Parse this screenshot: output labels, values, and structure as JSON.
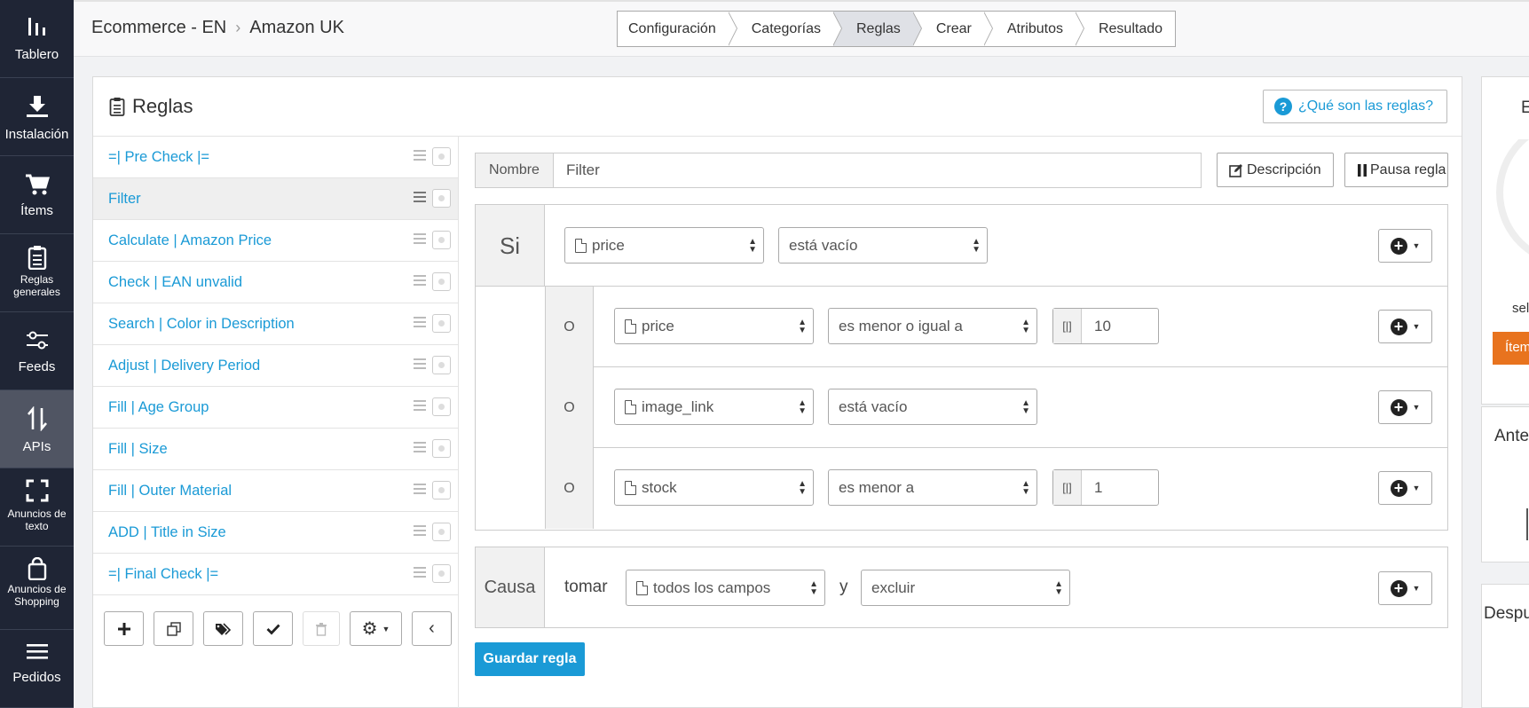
{
  "sidebar": {
    "items": [
      {
        "label": "Tablero",
        "icon": "dashboard-icon"
      },
      {
        "label": "Instalación",
        "icon": "download-icon"
      },
      {
        "label": "Ítems",
        "icon": "cart-icon"
      },
      {
        "label": "Reglas generales",
        "icon": "clipboard-icon"
      },
      {
        "label": "Feeds",
        "icon": "sliders-icon"
      },
      {
        "label": "APIs",
        "icon": "sort-arrows-icon"
      },
      {
        "label": "Anuncios de texto",
        "icon": "expand-icon"
      },
      {
        "label": "Anuncios de Shopping",
        "icon": "shopping-bag-icon"
      },
      {
        "label": "Pedidos",
        "icon": "list-icon"
      }
    ],
    "active": "APIs"
  },
  "breadcrumb": {
    "first": "Ecommerce - EN",
    "second": "Amazon UK"
  },
  "steps": [
    "Configuración",
    "Categorías",
    "Reglas",
    "Crear",
    "Atributos",
    "Resultado"
  ],
  "active_step": "Reglas",
  "panel": {
    "title": "Reglas",
    "help_label": "¿Qué son las reglas?"
  },
  "rules": [
    "=| Pre Check |=",
    "Filter",
    "Calculate | Amazon Price",
    "Check | EAN unvalid",
    "Search | Color in Description",
    "Adjust | Delivery Period",
    "Fill | Age Group",
    "Fill | Size",
    "Fill | Outer Material",
    "ADD | Title in Size",
    "=| Final Check |="
  ],
  "selected_rule": "Filter",
  "editor": {
    "name_label": "Nombre",
    "name_value": "Filter",
    "description_button": "Descripción",
    "pause_button": "Pausa regla",
    "if_label": "Si",
    "or_label": "O",
    "conditions": [
      {
        "field": "price",
        "operator": "está vacío",
        "value": null
      },
      {
        "field": "price",
        "operator": "es menor o igual a",
        "value": "10"
      },
      {
        "field": "image_link",
        "operator": "está vacío",
        "value": null
      },
      {
        "field": "stock",
        "operator": "es menor a",
        "value": "1"
      }
    ],
    "cause_label": "Causa",
    "take_label": "tomar",
    "take_field": "todos los campos",
    "and_label": "y",
    "action": "excluir",
    "save_button": "Guardar regla"
  },
  "right_column": {
    "top_letter": "E",
    "top_text": "sel",
    "orange_button": "Ítem",
    "card2_title": "Ante",
    "card3_title": "Despu"
  },
  "colors": {
    "sidebar_bg": "#1f2535",
    "link": "#1a9ad6",
    "accent_orange": "#e8731e",
    "active_nav": "#505563"
  }
}
